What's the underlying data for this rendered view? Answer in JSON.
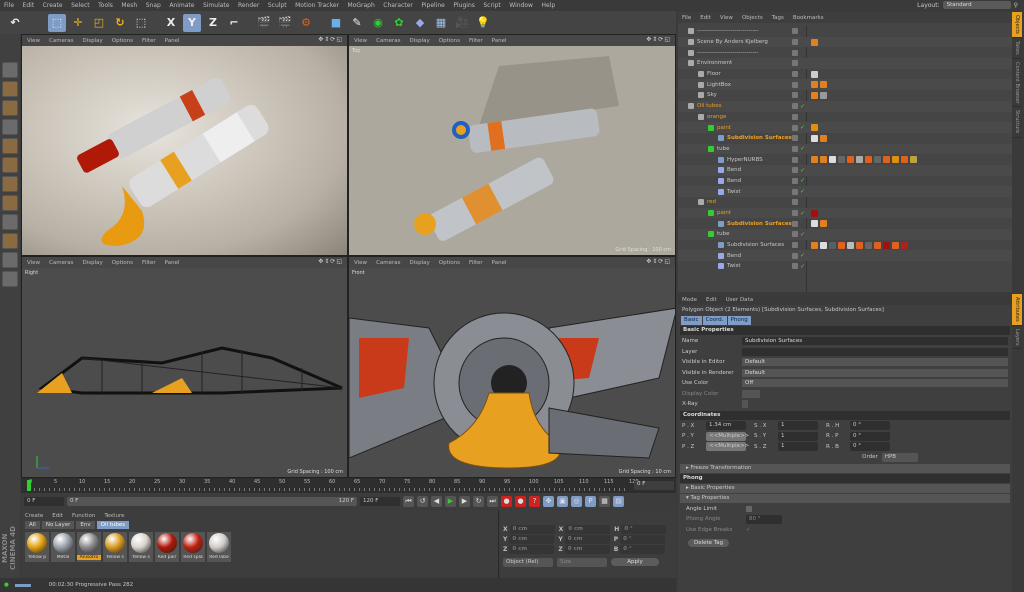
{
  "menubar": {
    "items": [
      "File",
      "Edit",
      "Create",
      "Select",
      "Tools",
      "Mesh",
      "Snap",
      "Animate",
      "Simulate",
      "Render",
      "Sculpt",
      "Motion Tracker",
      "MoGraph",
      "Character",
      "Pipeline",
      "Plugins",
      "Script",
      "Window",
      "Help"
    ],
    "layout_label": "Layout:",
    "layout_value": "Standard"
  },
  "toolbar": {
    "icons": [
      "undo-icon",
      "blank",
      "live-selection-icon",
      "move-icon",
      "scale-icon",
      "rotate-icon",
      "last-tool-icon",
      "sep",
      "x-axis-icon",
      "y-axis-icon",
      "z-axis-icon",
      "coordinate-system-icon",
      "sep",
      "render-view-icon",
      "render-picture-viewer-icon",
      "render-settings-icon",
      "sep",
      "cube-icon",
      "pen-icon",
      "subdivision-icon",
      "array-icon",
      "deformer-icon",
      "floor-icon",
      "camera-icon",
      "light-icon"
    ],
    "axis_labels": {
      "x": "X",
      "y": "Y",
      "z": "Z"
    }
  },
  "left_toolbar": {
    "icons": [
      "make-editable-icon",
      "model-mode-icon",
      "texture-mode-icon",
      "workplane-icon",
      "points-mode-icon",
      "edges-mode-icon",
      "polygons-mode-icon",
      "axis-mode-icon",
      "tweak-icon",
      "snap-icon",
      "locked-workplane-icon",
      "solo-icon"
    ]
  },
  "viewports": [
    {
      "menus": [
        "View",
        "Cameras",
        "Display",
        "Options",
        "Filter",
        "Panel"
      ],
      "label": "",
      "grid": ""
    },
    {
      "menus": [
        "View",
        "Cameras",
        "Display",
        "Options",
        "Filter",
        "Panel"
      ],
      "label": "Top",
      "grid": "Grid Spacing : 100 cm"
    },
    {
      "menus": [
        "View",
        "Cameras",
        "Display",
        "Options",
        "Filter",
        "Panel"
      ],
      "label": "Right",
      "grid": "Grid Spacing : 100 cm"
    },
    {
      "menus": [
        "View",
        "Cameras",
        "Display",
        "Options",
        "Filter",
        "Panel"
      ],
      "label": "Front",
      "grid": "Grid Spacing : 10 cm"
    }
  ],
  "timeline": {
    "ticks": [
      0,
      5,
      10,
      15,
      20,
      25,
      30,
      35,
      40,
      45,
      50,
      55,
      60,
      65,
      70,
      75,
      80,
      85,
      90,
      95,
      100,
      105,
      110,
      115,
      120
    ],
    "current_frame": "0 F",
    "start": "0 F",
    "range_start": "0 F",
    "range_end": "120 F",
    "end": "120 F",
    "playhead": 0
  },
  "materials": {
    "menu": [
      "Create",
      "Edit",
      "Function",
      "Texture"
    ],
    "tabs": [
      "All",
      "No Layer",
      "Env",
      "Oil tubes"
    ],
    "selected_tab": 3,
    "items": [
      {
        "name": "Yellow p",
        "color": "#e0a010"
      },
      {
        "name": "Metal",
        "color": "#9aa0a8"
      },
      {
        "name": "Anisotro",
        "color": "#8a8a8a",
        "selected": true
      },
      {
        "name": "Yellow s",
        "color": "#d89a20"
      },
      {
        "name": "Yellow s",
        "color": "#d8d4cc"
      },
      {
        "name": "Red pair",
        "color": "#b01808"
      },
      {
        "name": "Red spla",
        "color": "#c02010"
      },
      {
        "name": "Red labe",
        "color": "#d0ccc8"
      }
    ]
  },
  "coordinates": {
    "cols": [
      "X",
      "Y",
      "Z"
    ],
    "pos": [
      "0 cm",
      "0 cm",
      "0 cm"
    ],
    "size": [
      "0 cm",
      "0 cm",
      "0 cm"
    ],
    "rot_labels": [
      "H",
      "P",
      "B"
    ],
    "rot": [
      "0 °",
      "0 °",
      "0 °"
    ],
    "mode": "Object (Rel)",
    "size_mode": "Size",
    "apply": "Apply"
  },
  "status": {
    "text": "00:02:30 Progressive Pass 282"
  },
  "objects": {
    "menu": [
      "File",
      "Edit",
      "View",
      "Objects",
      "Tags",
      "Bookmarks"
    ],
    "rows": [
      {
        "name": "-------------------------------",
        "level": 0,
        "color": "#c8c8c8",
        "tags": []
      },
      {
        "name": "Scene By Anders Kjelberg",
        "level": 0,
        "color": "#c8c8c8",
        "tags": [
          "#e08020"
        ]
      },
      {
        "name": "-------------------------------",
        "level": 0,
        "color": "#c8c8c8",
        "tags": []
      },
      {
        "name": "Environment",
        "level": 0,
        "color": "#c8c8c8",
        "tags": []
      },
      {
        "name": "Floor",
        "level": 1,
        "color": "#c8c8c8",
        "tags": [
          "#cccccc"
        ]
      },
      {
        "name": "LightBox",
        "level": 1,
        "color": "#c8c8c8",
        "tags": [
          "#e08020",
          "#e08020"
        ]
      },
      {
        "name": "Sky",
        "level": 1,
        "color": "#c8c8c8",
        "tags": [
          "#e08020",
          "#999999"
        ]
      },
      {
        "name": "Oil tubes",
        "level": 0,
        "color": "#e8a020",
        "tags": []
      },
      {
        "name": "orange",
        "level": 1,
        "color": "#e8a020",
        "tags": []
      },
      {
        "name": "paint",
        "level": 2,
        "color": "#e8a020",
        "tags": [
          "#e09010"
        ]
      },
      {
        "name": "Subdivision Surfaces",
        "level": 3,
        "color": "#f0a020",
        "bold": true,
        "tags": [
          "#dddddd",
          "#e08020"
        ]
      },
      {
        "name": "tube",
        "level": 2,
        "color": "#c8c8c8",
        "tags": []
      },
      {
        "name": "HyperNURBS",
        "level": 3,
        "color": "#c8c8c8",
        "tags": [
          "#e08020",
          "#e08020",
          "#dddddd",
          "#666666",
          "#e06020",
          "#aaaaaa",
          "#e06020",
          "#666666",
          "#e06020",
          "#e09010",
          "#e06020",
          "#c0a040"
        ]
      },
      {
        "name": "Bend",
        "level": 3,
        "color": "#c8c8c8",
        "tags": []
      },
      {
        "name": "Bend",
        "level": 3,
        "color": "#c8c8c8",
        "tags": []
      },
      {
        "name": "Twist",
        "level": 3,
        "color": "#c8c8c8",
        "tags": []
      },
      {
        "name": "red",
        "level": 1,
        "color": "#e8a020",
        "tags": []
      },
      {
        "name": "paint",
        "level": 2,
        "color": "#e8a020",
        "tags": [
          "#a01010"
        ]
      },
      {
        "name": "Subdivision Surfaces",
        "level": 3,
        "color": "#f0a020",
        "bold": true,
        "tags": [
          "#dddddd",
          "#e08020"
        ]
      },
      {
        "name": "tube",
        "level": 2,
        "color": "#c8c8c8",
        "tags": []
      },
      {
        "name": "Subdivision Surfaces",
        "level": 3,
        "color": "#c8c8c8",
        "tags": [
          "#e08020",
          "#dddddd",
          "#556060",
          "#e06020",
          "#bbbbbb",
          "#e06020",
          "#666666",
          "#e06020",
          "#a01010",
          "#e06020",
          "#b02020"
        ]
      },
      {
        "name": "Bend",
        "level": 3,
        "color": "#c8c8c8",
        "tags": []
      },
      {
        "name": "Twist",
        "level": 3,
        "color": "#c8c8c8",
        "tags": []
      }
    ]
  },
  "attributes": {
    "menu": [
      "Mode",
      "Edit",
      "User Data"
    ],
    "title": "Polygon Object (2 Elements) [Subdivision Surfaces, Subdivision Surfaces]",
    "tabs": [
      "Basic",
      "Coord.",
      "Phong"
    ],
    "basic_header": "Basic Properties",
    "fields": [
      {
        "label": "Name",
        "value": "Subdivision Surfaces"
      },
      {
        "label": "Layer",
        "value": ""
      },
      {
        "label": "Visible in Editor",
        "value": "Default",
        "dd": true
      },
      {
        "label": "Visible in Renderer",
        "value": "Default",
        "dd": true
      },
      {
        "label": "Use Color",
        "value": "Off",
        "dd": true
      },
      {
        "label": "Display Color",
        "value": "",
        "dim": true
      },
      {
        "label": "X-Ray",
        "value": ""
      }
    ],
    "coord_header": "Coordinates",
    "coords": [
      [
        "P . X",
        "1.34 cm",
        "S . X",
        "1",
        "R . H",
        "0 °"
      ],
      [
        "P . Y",
        "<<Multiple>>",
        "S . Y",
        "1",
        "R . P",
        "0 °"
      ],
      [
        "P . Z",
        "<<Multiple>>",
        "S . Z",
        "1",
        "R . B",
        "0 °"
      ]
    ],
    "order_label": "Order",
    "order_value": "HPB",
    "freeze": "Freeze Transformation",
    "phong_header": "Phong",
    "phong_basic": "Basic Properties",
    "tag_props": "Tag Properties",
    "angle_limit": "Angle Limit",
    "phong_angle": "Phong Angle",
    "phong_angle_value": "80 °",
    "edge_breaks": "Use Edge Breaks",
    "delete_tag": "Delete Tag"
  },
  "right_tabs_top": [
    "Objects",
    "Takes",
    "Content Browser",
    "Structure"
  ],
  "right_tabs_bottom": [
    "Attributes",
    "Layers"
  ],
  "brand": "MAXON CINEMA 4D"
}
